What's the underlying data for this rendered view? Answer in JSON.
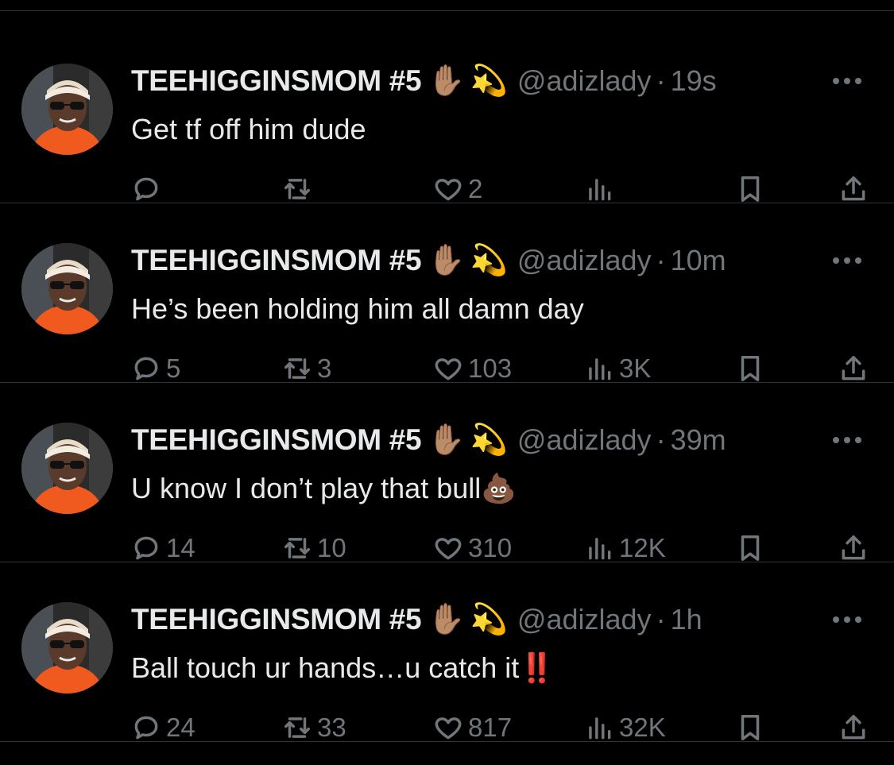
{
  "tweets": [
    {
      "name": "TEEHIGGINSMOM #5",
      "emoji1": "✋🏽",
      "emoji2": "💫",
      "handle": "@adizlady",
      "sep": "·",
      "time": "19s",
      "text": "Get tf off him dude",
      "replies": "",
      "retweets": "",
      "likes": "2",
      "views": ""
    },
    {
      "name": "TEEHIGGINSMOM #5",
      "emoji1": "✋🏽",
      "emoji2": "💫",
      "handle": "@adizlady",
      "sep": "·",
      "time": "10m",
      "text": "He’s been holding him all damn day",
      "replies": "5",
      "retweets": "3",
      "likes": "103",
      "views": "3K"
    },
    {
      "name": "TEEHIGGINSMOM #5",
      "emoji1": "✋🏽",
      "emoji2": "💫",
      "handle": "@adizlady",
      "sep": "·",
      "time": "39m",
      "text": "U know I don’t play that bull💩",
      "replies": "14",
      "retweets": "10",
      "likes": "310",
      "views": "12K"
    },
    {
      "name": "TEEHIGGINSMOM #5",
      "emoji1": "✋🏽",
      "emoji2": "💫",
      "handle": "@adizlady",
      "sep": "·",
      "time": "1h",
      "text": "Ball touch ur hands…u catch it‼️",
      "replies": "24",
      "retweets": "33",
      "likes": "817",
      "views": "32K"
    }
  ],
  "icons": {
    "reply": "reply-icon",
    "retweet": "retweet-icon",
    "like": "heart-icon",
    "views": "views-icon",
    "bookmark": "bookmark-icon",
    "share": "share-icon",
    "more": "more-icon"
  },
  "colors": {
    "background": "#000000",
    "text": "#e7e9ea",
    "secondary": "#71767b",
    "divider": "#2f3336",
    "avatar_shirt": "#f05a1f"
  }
}
